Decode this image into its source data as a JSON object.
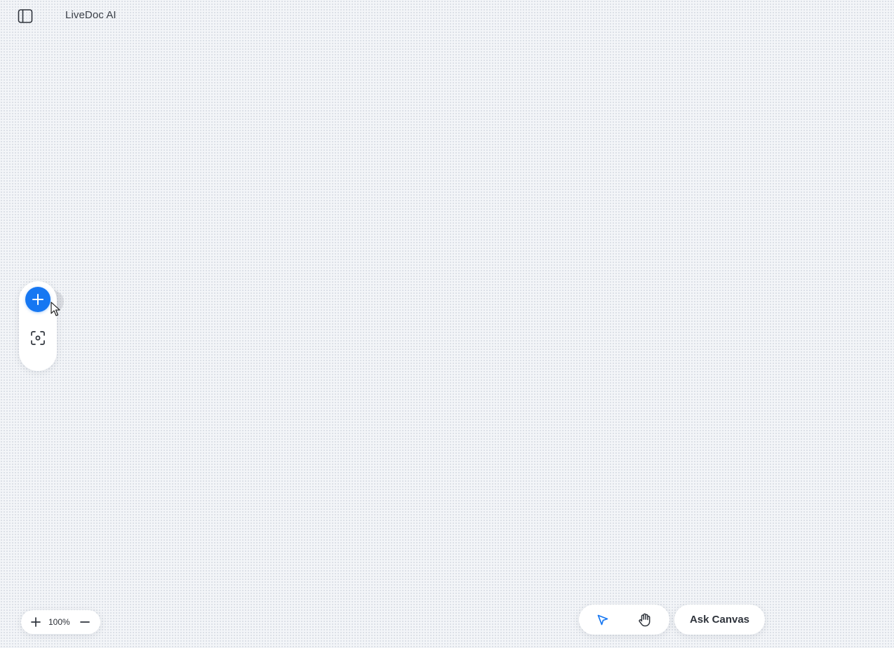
{
  "header": {
    "title": "LiveDoc AI",
    "sidebar_toggle_icon": "sidebar-panel-icon"
  },
  "left_toolbar": {
    "add_icon": "plus-icon",
    "focus_icon": "focus-frame-icon",
    "add_button_color": "#1677f2"
  },
  "zoom": {
    "level": "100%",
    "zoom_in_icon": "plus-icon",
    "zoom_out_icon": "minus-icon"
  },
  "tools": {
    "select_icon": "pointer-arrow-icon",
    "hand_icon": "hand-icon",
    "active_tool": "select",
    "active_color": "#1677f2"
  },
  "ask_canvas": {
    "label": "Ask Canvas"
  }
}
